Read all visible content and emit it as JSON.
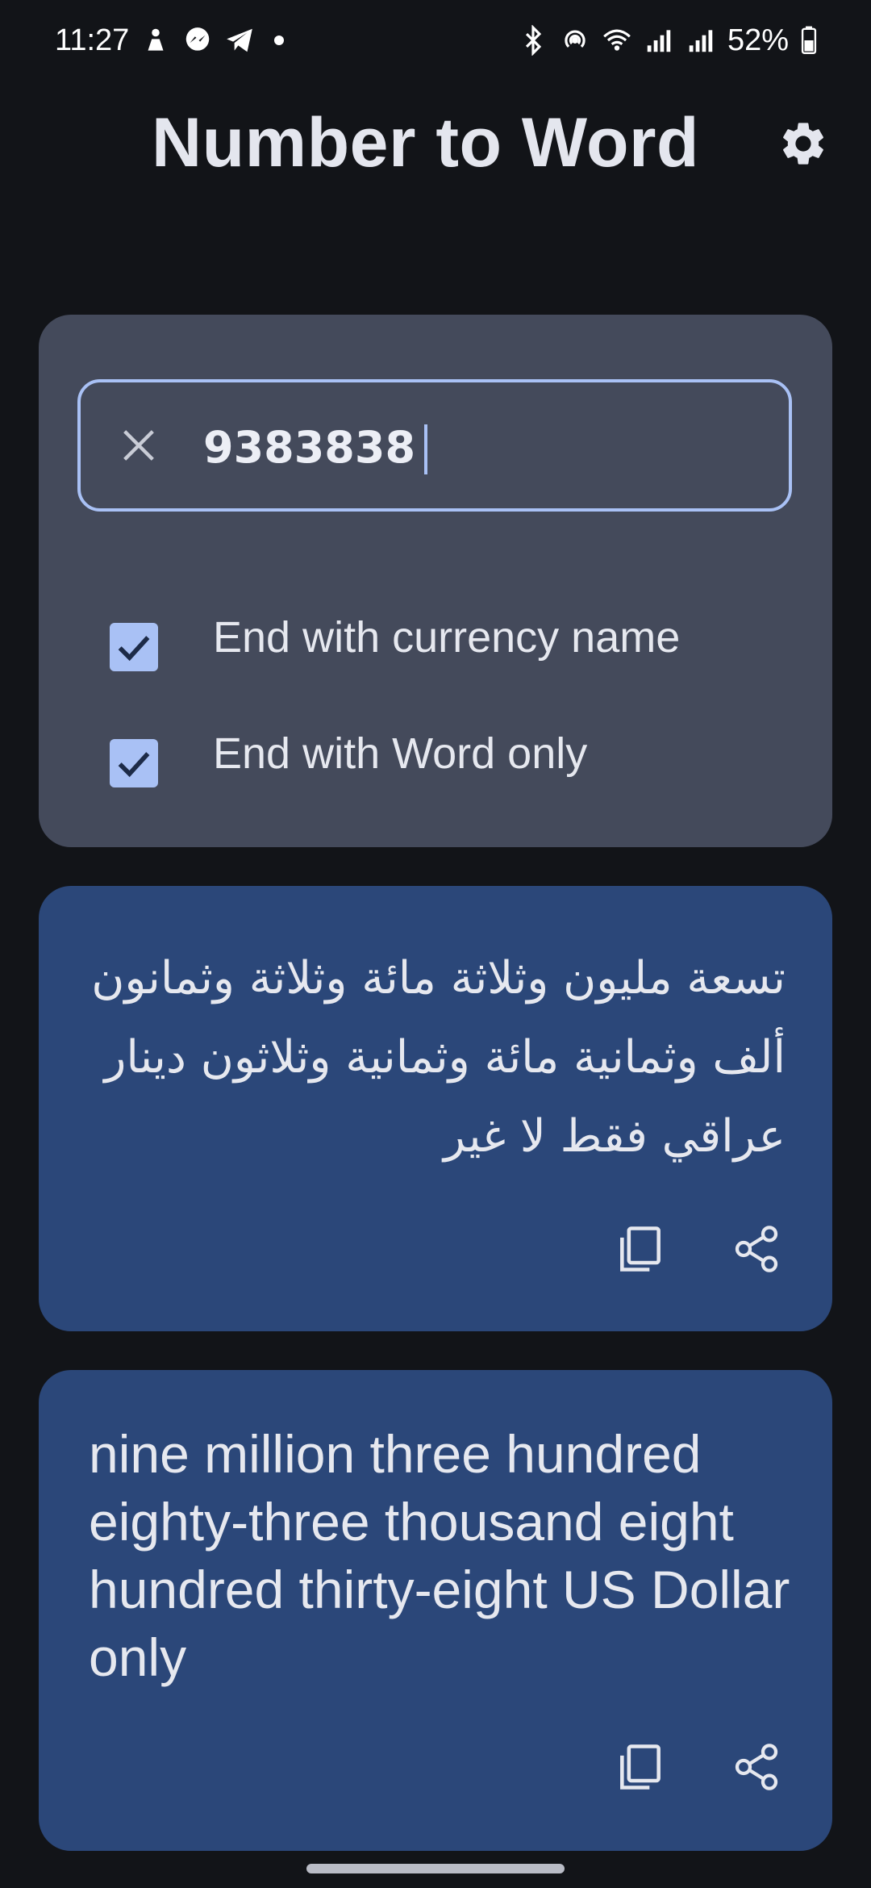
{
  "status_bar": {
    "time": "11:27",
    "battery": "52%",
    "notification_icons": [
      "person-icon",
      "messenger-icon",
      "telegram-icon",
      "dot-icon"
    ],
    "system_icons": [
      "bluetooth-icon",
      "hotspot-icon",
      "wifi-icon",
      "signal-icon",
      "signal-icon",
      "battery-icon"
    ]
  },
  "app_bar": {
    "title": "Number to Word",
    "settings_icon": "gear-icon"
  },
  "input_card": {
    "number_value": "9383838",
    "clear_icon": "close-icon",
    "options": [
      {
        "label": "End with currency name",
        "checked": true
      },
      {
        "label": "End with Word only",
        "checked": true
      }
    ]
  },
  "results": {
    "arabic": {
      "text": "تسعة مليون وثلاثة مائة وثلاثة وثمانون ألف وثمانية مائة وثمانية وثلاثون دينار عراقي فقط لا غير",
      "copy_icon": "copy-icon",
      "share_icon": "share-icon"
    },
    "english": {
      "text": "nine million three hundred eighty-three thousand eight hundred thirty-eight US Dollar only",
      "copy_icon": "copy-icon",
      "share_icon": "share-icon"
    }
  },
  "colors": {
    "background": "#121418",
    "input_card": "#444a5b",
    "result_card": "#2b4779",
    "accent": "#a9c1f5"
  }
}
